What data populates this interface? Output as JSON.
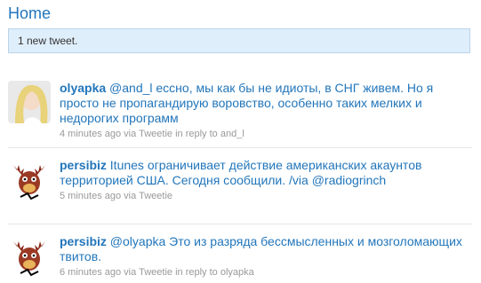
{
  "header": {
    "title": "Home"
  },
  "notice": {
    "text": "1 new tweet."
  },
  "tweets": [
    {
      "user": "olyapka",
      "mention": "@and_l",
      "text": " ессно, мы как бы не идиоты, в СНГ живем. Но я просто не пропагандирую воровство, особенно таких мелких и недорогих программ",
      "time": "4 minutes ago",
      "via_word": "via",
      "source": "Tweetie",
      "reply_word": "in reply to",
      "reply_to": "and_l"
    },
    {
      "user": "persibiz",
      "text": "Itunes ограничивает действие американских акаунтов территорией США. Сегодня сообщили. /via",
      "mention2": "@radiogrinch",
      "time": "5 minutes ago",
      "via_word": "via",
      "source": "Tweetie"
    },
    {
      "user": "persibiz",
      "mention": "@olyapka",
      "text": " Это из разряда бессмысленных и мозголомающих твитов.",
      "time": "6 minutes ago",
      "via_word": "via",
      "source": "Tweetie",
      "reply_word": "in reply to",
      "reply_to": "olyapka"
    }
  ]
}
